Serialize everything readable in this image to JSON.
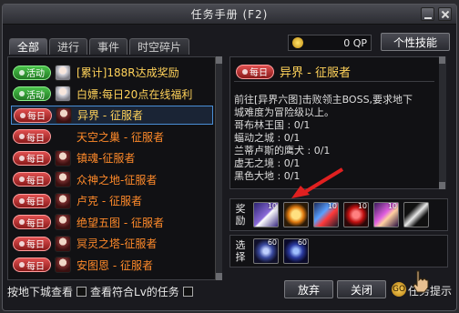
{
  "window": {
    "title": "任务手册 (F2)"
  },
  "tabs": [
    {
      "label": "全部",
      "active": true
    },
    {
      "label": "进行",
      "active": false
    },
    {
      "label": "事件",
      "active": false
    },
    {
      "label": "时空碎片",
      "active": false
    }
  ],
  "qp": {
    "icon": "qp-coin-icon",
    "value": "0 QP"
  },
  "skill_button": {
    "label": "个性技能"
  },
  "quests": [
    {
      "tag": "活动",
      "tag_color": "#3aa83a",
      "avatar": "white",
      "text": "[累计]188R达成奖励",
      "text_color": "#ffd25a",
      "selected": false
    },
    {
      "tag": "活动",
      "tag_color": "#3aa83a",
      "avatar": "white",
      "text": "白嫖:每日20点在线福利",
      "text_color": "#ffd25a",
      "selected": false
    },
    {
      "tag": "每日",
      "tag_color": "#c83030",
      "avatar": "red",
      "text": "异界 - 征服者",
      "text_color": "#ffd25a",
      "selected": true
    },
    {
      "tag": "每日",
      "tag_color": "#c83030",
      "avatar": "none",
      "text": "天空之巢 - 征服者",
      "text_color": "#ff8a2a",
      "selected": false
    },
    {
      "tag": "每日",
      "tag_color": "#c83030",
      "avatar": "red",
      "text": "镇魂-征服者",
      "text_color": "#ff8a2a",
      "selected": false
    },
    {
      "tag": "每日",
      "tag_color": "#c83030",
      "avatar": "red",
      "text": "众神之地-征服者",
      "text_color": "#ff8a2a",
      "selected": false
    },
    {
      "tag": "每日",
      "tag_color": "#c83030",
      "avatar": "red",
      "text": "卢克 - 征服者",
      "text_color": "#ff8a2a",
      "selected": false
    },
    {
      "tag": "每日",
      "tag_color": "#c83030",
      "avatar": "red",
      "text": "绝望五图 - 征服者",
      "text_color": "#ff8a2a",
      "selected": false
    },
    {
      "tag": "每日",
      "tag_color": "#c83030",
      "avatar": "red",
      "text": "冥灵之塔-征服者",
      "text_color": "#ff8a2a",
      "selected": false
    },
    {
      "tag": "每日",
      "tag_color": "#c83030",
      "avatar": "red",
      "text": "安图恩 - 征服者",
      "text_color": "#ff8a2a",
      "selected": false
    }
  ],
  "detail": {
    "tag": "每日",
    "title": "异界 - 征服者",
    "body": [
      "前往[异界六图]击败领主BOSS,要求地下",
      "城难度为冒险级以上。",
      "哥布林王国 : 0/1",
      "蝠动之城 : 0/1",
      "兰蒂卢斯的鹰犬 : 0/1",
      "虚无之境 : 0/1",
      "黑色大地 : 0/1"
    ]
  },
  "rewards": {
    "label": "奖励",
    "items": [
      {
        "icon": "crystal-weapon-icon",
        "count": "10",
        "class": "it1"
      },
      {
        "icon": "gold-orb-icon",
        "count": "",
        "class": "it2"
      },
      {
        "icon": "blade-icon",
        "count": "10",
        "class": "it3"
      },
      {
        "icon": "red-gem-icon",
        "count": "10",
        "class": "it4"
      },
      {
        "icon": "character-card-icon",
        "count": "10",
        "class": "it5"
      },
      {
        "icon": "slash-icon",
        "count": "",
        "class": "it6"
      }
    ]
  },
  "choices": {
    "label": "选择",
    "items": [
      {
        "icon": "blue-star-icon",
        "count": "60",
        "class": "it7"
      },
      {
        "icon": "dark-star-icon",
        "count": "60",
        "class": "it8"
      }
    ]
  },
  "bottom": {
    "dungeon_view": "按地下城查看",
    "lv_filter": "查看符合Lv的任务"
  },
  "buttons": {
    "abandon": "放弃",
    "close": "关闭"
  },
  "hint": {
    "icon": "GO",
    "text": "任务提示"
  }
}
